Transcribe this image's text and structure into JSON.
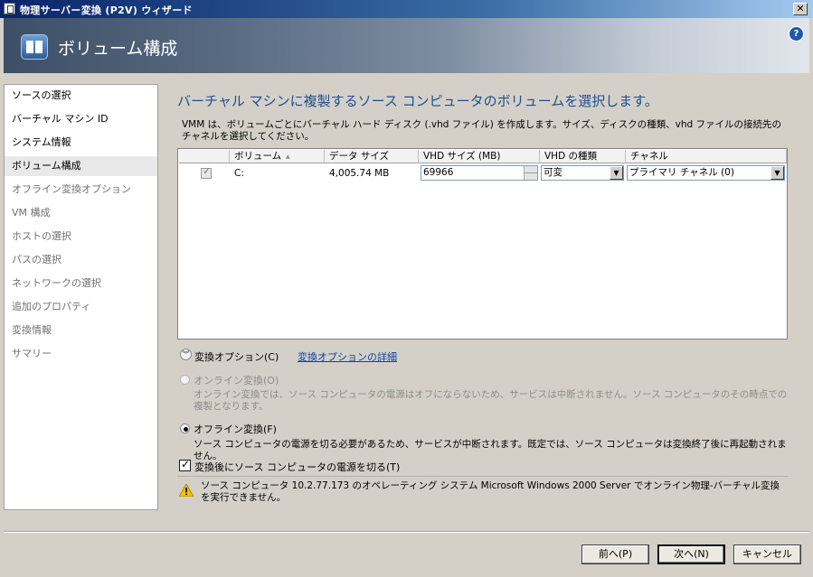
{
  "window": {
    "title": "物理サーバー変換 (P2V) ウィザード",
    "close_glyph": "✕",
    "help_glyph": "?"
  },
  "header": {
    "title": "ボリューム構成"
  },
  "nav": {
    "items": [
      {
        "label": "ソースの選択",
        "state": "done"
      },
      {
        "label": "バーチャル マシン ID",
        "state": "done"
      },
      {
        "label": "システム情報",
        "state": "done"
      },
      {
        "label": "ボリューム構成",
        "state": "active"
      },
      {
        "label": "オフライン変換オプション",
        "state": "pending"
      },
      {
        "label": "VM 構成",
        "state": "pending"
      },
      {
        "label": "ホストの選択",
        "state": "pending"
      },
      {
        "label": "パスの選択",
        "state": "pending"
      },
      {
        "label": "ネットワークの選択",
        "state": "pending"
      },
      {
        "label": "追加のプロパティ",
        "state": "pending"
      },
      {
        "label": "変換情報",
        "state": "pending"
      },
      {
        "label": "サマリー",
        "state": "pending"
      }
    ]
  },
  "main": {
    "title": "バーチャル マシンに複製するソース コンピュータのボリュームを選択します。",
    "description": "VMM は、ボリュームごとにバーチャル ハード ディスク (.vhd ファイル) を作成します。サイズ、ディスクの種類、vhd ファイルの接続先のチャネルを選択してください。",
    "grid": {
      "columns": [
        "ボリューム",
        "データ サイズ",
        "VHD サイズ (MB)",
        "VHD の種類",
        "チャネル"
      ],
      "sort_glyph": "▲",
      "rows": [
        {
          "selected": true,
          "volume": "C:",
          "data_size": "4,005.74 MB",
          "vhd_size": "69966",
          "vhd_type": "可変",
          "channel": "プライマリ チャネル (0)"
        }
      ]
    },
    "options": {
      "expander_label": "変換オプション(C)",
      "details_link": "変換オプションの詳細",
      "online": {
        "label": "オンライン変換(O)",
        "description": "オンライン変換では、ソース コンピュータの電源はオフにならないため、サービスは中断されません。ソース コンピュータのその時点での複製となります。",
        "selected": false,
        "enabled": false
      },
      "offline": {
        "label": "オフライン変換(F)",
        "description": "ソース コンピュータの電源を切る必要があるため、サービスが中断されます。既定では、ソース コンピュータは変換終了後に再起動されません。",
        "selected": true
      },
      "power_off": {
        "label": "変換後にソース コンピュータの電源を切る(T)",
        "checked": true
      }
    },
    "warning": "ソース コンピュータ 10.2.77.173 のオペレーティング システム Microsoft Windows 2000 Server でオンライン物理-バーチャル変換を実行できません。"
  },
  "buttons": {
    "back": "前へ(P)",
    "next": "次へ(N)",
    "cancel": "キャンセル"
  },
  "colors": {
    "title_accent": "#1d4f91",
    "link": "#0645ad",
    "warning": "#f2c200"
  }
}
